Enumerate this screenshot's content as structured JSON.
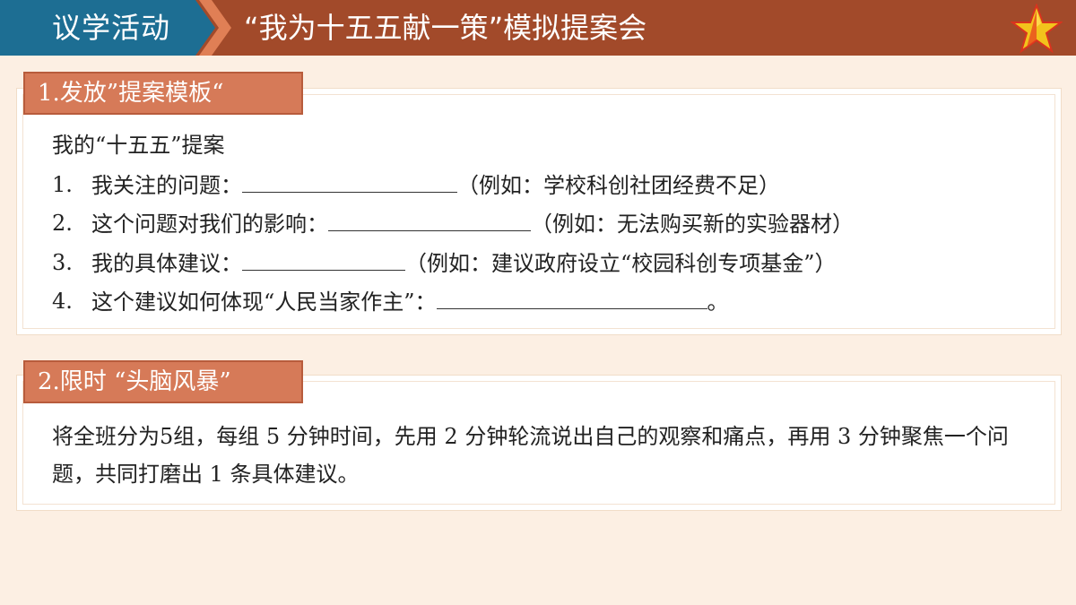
{
  "header": {
    "tag": "议学活动",
    "title": "“我为十五五献一策”模拟提案会",
    "colors": {
      "bar": "#a24a2a",
      "tag": "#1d6e93",
      "star": "#f2c31c"
    },
    "icon": "star-icon"
  },
  "section1": {
    "tab_label": "1.发放”提案模板“",
    "heading": "我的“十五五”提案",
    "items": [
      {
        "num": "1.",
        "label": "我关注的问题：",
        "example": "（例如：学校科创社团经费不足）"
      },
      {
        "num": "2.",
        "label": "这个问题对我们的影响：",
        "example": "（例如：无法购买新的实验器材）"
      },
      {
        "num": "3.",
        "label": "我的具体建议：",
        "example": "（例如：建议政府设立“校园科创专项基金”）"
      },
      {
        "num": "4.",
        "label": "这个建议如何体现“人民当家作主”：",
        "example": "。"
      }
    ]
  },
  "section2": {
    "tab_label": "2.限时 “头脑风暴”",
    "paragraph": "将全班分为5组，每组 5 分钟时间，先用 2 分钟轮流说出自己的观察和痛点，再用 3 分钟聚焦一个问题，共同打磨出 1 条具体建议。"
  },
  "colors": {
    "background": "#fcefe3",
    "section_tab": "#d67a58"
  }
}
